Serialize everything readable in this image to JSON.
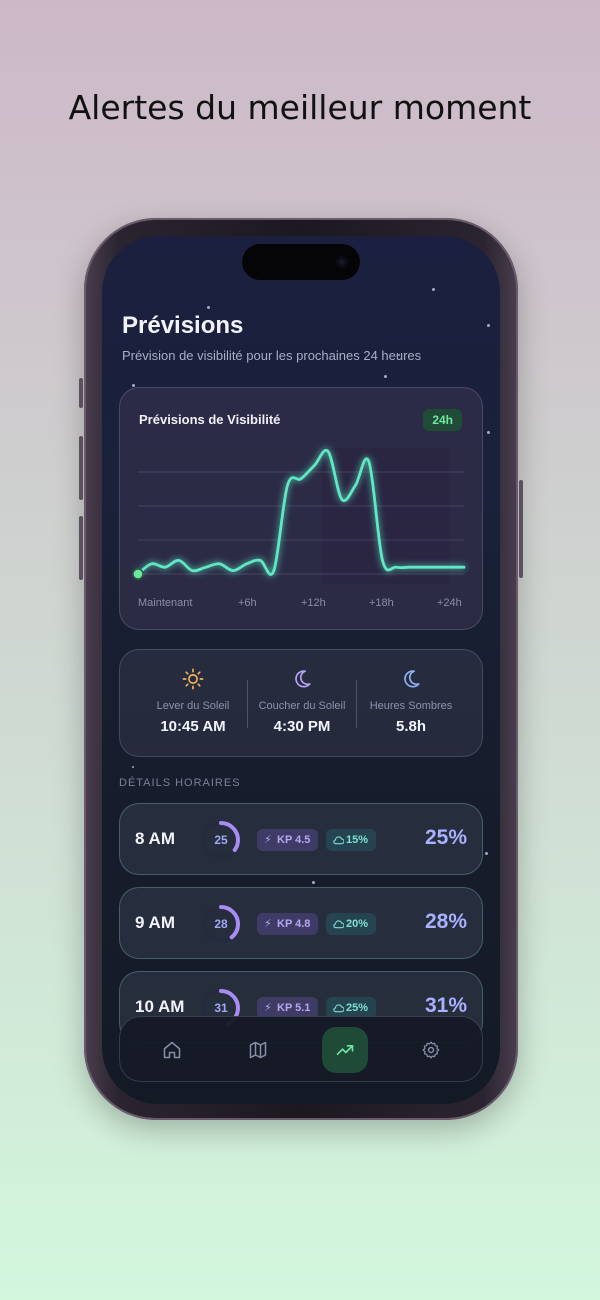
{
  "headline": "Alertes du meilleur moment",
  "screen": {
    "title": "Prévisions",
    "subtitle": "Prévision de visibilité pour les prochaines 24 heures"
  },
  "chart_data": {
    "type": "line",
    "title": "Prévisions de Visibilité",
    "badge": "24h",
    "x_tick_labels": [
      "Maintenant",
      "+6h",
      "+12h",
      "+18h",
      "+24h"
    ],
    "x": [
      0,
      1,
      2,
      3,
      4,
      5,
      6,
      7,
      8,
      9,
      10,
      11,
      12,
      13,
      14,
      15,
      16,
      17,
      18,
      19,
      20,
      21,
      22,
      23,
      24
    ],
    "values": [
      0,
      3,
      2,
      4,
      1,
      2,
      3,
      1,
      3,
      4,
      1,
      26,
      28,
      32,
      36,
      22,
      26,
      33,
      4,
      2,
      2,
      2,
      2,
      2,
      2
    ],
    "ylim": [
      0,
      40
    ],
    "grid": true,
    "line_color": "#5fe8c4"
  },
  "sun": {
    "sunrise": {
      "label": "Lever du Soleil",
      "value": "10:45 AM",
      "icon": "sun-icon"
    },
    "sunset": {
      "label": "Coucher du Soleil",
      "value": "4:30 PM",
      "icon": "moon-icon"
    },
    "dark": {
      "label": "Heures Sombres",
      "value": "5.8h",
      "icon": "moon-icon"
    }
  },
  "section_label": "DÉTAILS HORAIRES",
  "hours": [
    {
      "time": "8 AM",
      "score": "25",
      "score_value": 25,
      "kp": "KP 4.5",
      "cloud": "15%",
      "pct": "25%"
    },
    {
      "time": "9 AM",
      "score": "28",
      "score_value": 28,
      "kp": "KP 4.8",
      "cloud": "20%",
      "pct": "28%"
    },
    {
      "time": "10 AM",
      "score": "31",
      "score_value": 31,
      "kp": "KP 5.1",
      "cloud": "25%",
      "pct": "31%"
    }
  ],
  "nav": {
    "items": [
      {
        "icon": "home-icon"
      },
      {
        "icon": "map-icon"
      },
      {
        "icon": "chart-icon",
        "active": true
      },
      {
        "icon": "gear-icon"
      }
    ],
    "accent": "#6ee7a0"
  }
}
